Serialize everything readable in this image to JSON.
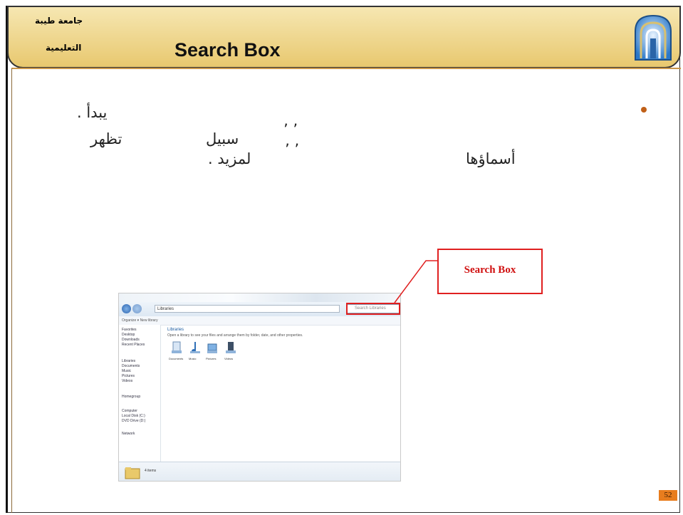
{
  "header": {
    "university_line1": "جامعة طيبة",
    "university_line2": "التعليمية",
    "title": "Search Box"
  },
  "body_text": {
    "line1": ". يبدأ",
    "line2_a": "’ ’",
    "line2_b": "سبيل",
    "line2_c": "تظهر",
    "line3_a": "أسماؤها",
    "line3_b": "’ ’",
    "line3_c": ". لمزيد"
  },
  "callout": {
    "label": "Search Box"
  },
  "screenshot": {
    "address": "Libraries",
    "search_placeholder": "Search Libraries",
    "cmdbar": "Organize ▾   New library",
    "library_title": "Libraries",
    "library_desc": "Open a library to see your files and arrange them by folder, date, and other properties.",
    "libraries": [
      "Documents",
      "Music",
      "Pictures",
      "Videos"
    ],
    "nav": [
      "Favorites",
      "Desktop",
      "Downloads",
      "Recent Places",
      "Libraries",
      "Documents",
      "Music",
      "Pictures",
      "Videos",
      "Homegroup",
      "Computer",
      "Local Disk (C:)",
      "DVD Drive (D:)",
      "Network"
    ],
    "status": "4 items"
  },
  "page_number": "52",
  "colors": {
    "accent": "#e87d1e",
    "callout": "#e02020",
    "header_top": "#f6e7b2"
  }
}
